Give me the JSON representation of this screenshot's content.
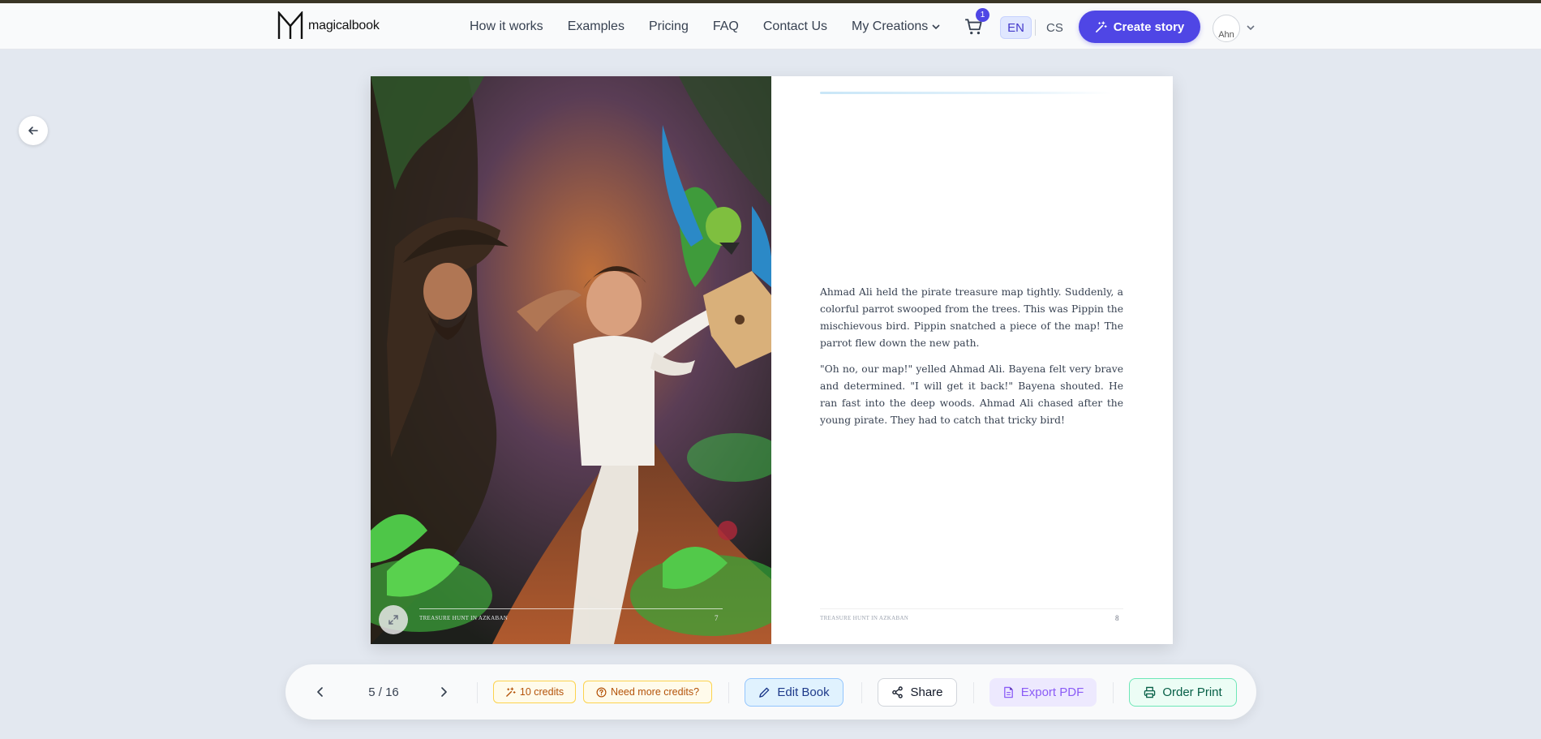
{
  "brand": {
    "name": "magicalbook",
    "logo_icon": "m-logo-icon"
  },
  "nav": {
    "links": [
      "How it works",
      "Examples",
      "Pricing",
      "FAQ",
      "Contact Us"
    ],
    "my_creations": "My Creations"
  },
  "cart": {
    "count": "1"
  },
  "language": {
    "en": "EN",
    "cs": "CS"
  },
  "create_button": {
    "label": "Create story"
  },
  "avatar": {
    "alt": "Ahn"
  },
  "book": {
    "footer_title": "TREASURE HUNT IN AZKABAN",
    "left_page_number": "7",
    "right_page_number": "8",
    "paragraphs": [
      "Ahmad Ali held the pirate treasure map tightly. Suddenly, a colorful parrot swooped from the trees. This was Pippin the mischievous bird. Pippin snatched a piece of the map! The parrot flew down the new path.",
      "\"Oh no, our map!\" yelled Ahmad Ali. Bayena felt very brave and determined. \"I will get it back!\" Bayena shouted. He ran fast into the deep woods. Ahmad Ali chased after the young pirate. They had to catch that tricky bird!"
    ]
  },
  "toolbar": {
    "pager": "5 / 16",
    "credits": "10 credits",
    "need_more": "Need more credits?",
    "edit": "Edit Book",
    "share": "Share",
    "export_pdf": "Export PDF",
    "order_print": "Order Print"
  },
  "colors": {
    "accent": "#4f46e5",
    "credits": "#b45309",
    "edit": "#1e3a8a",
    "pdf": "#8b5cf6",
    "print": "#065f46"
  }
}
